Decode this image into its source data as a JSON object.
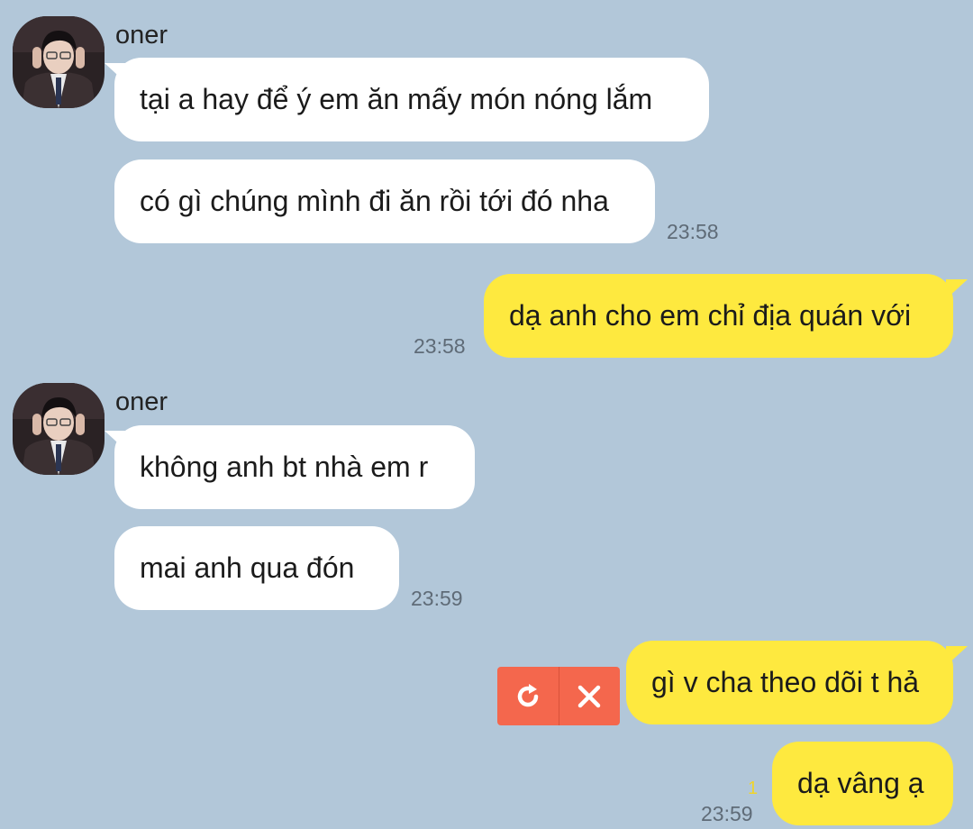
{
  "chat": {
    "accent_colors": {
      "background": "#b2c7d9",
      "incoming_bubble": "#ffffff",
      "outgoing_bubble": "#fee93f",
      "failed_action": "#f4674d"
    },
    "groups": [
      {
        "sender": "oner",
        "messages": [
          "tại a hay để ý em ăn mấy món nóng lắm",
          "có gì chúng mình đi ăn rồi tới đó nha"
        ],
        "time": "23:58"
      },
      {
        "sender": "me",
        "messages": [
          "dạ anh cho em chỉ địa quán với"
        ],
        "time": "23:58"
      },
      {
        "sender": "oner",
        "messages": [
          "không anh bt nhà em r",
          "mai anh qua đón"
        ],
        "time": "23:59"
      },
      {
        "sender": "me",
        "failed_message": "gì v cha theo dõi t hả",
        "retry_icon": "retry-icon",
        "delete_icon": "close-icon",
        "messages": [
          "dạ vâng ạ"
        ],
        "unread_count": "1",
        "time": "23:59"
      }
    ]
  }
}
